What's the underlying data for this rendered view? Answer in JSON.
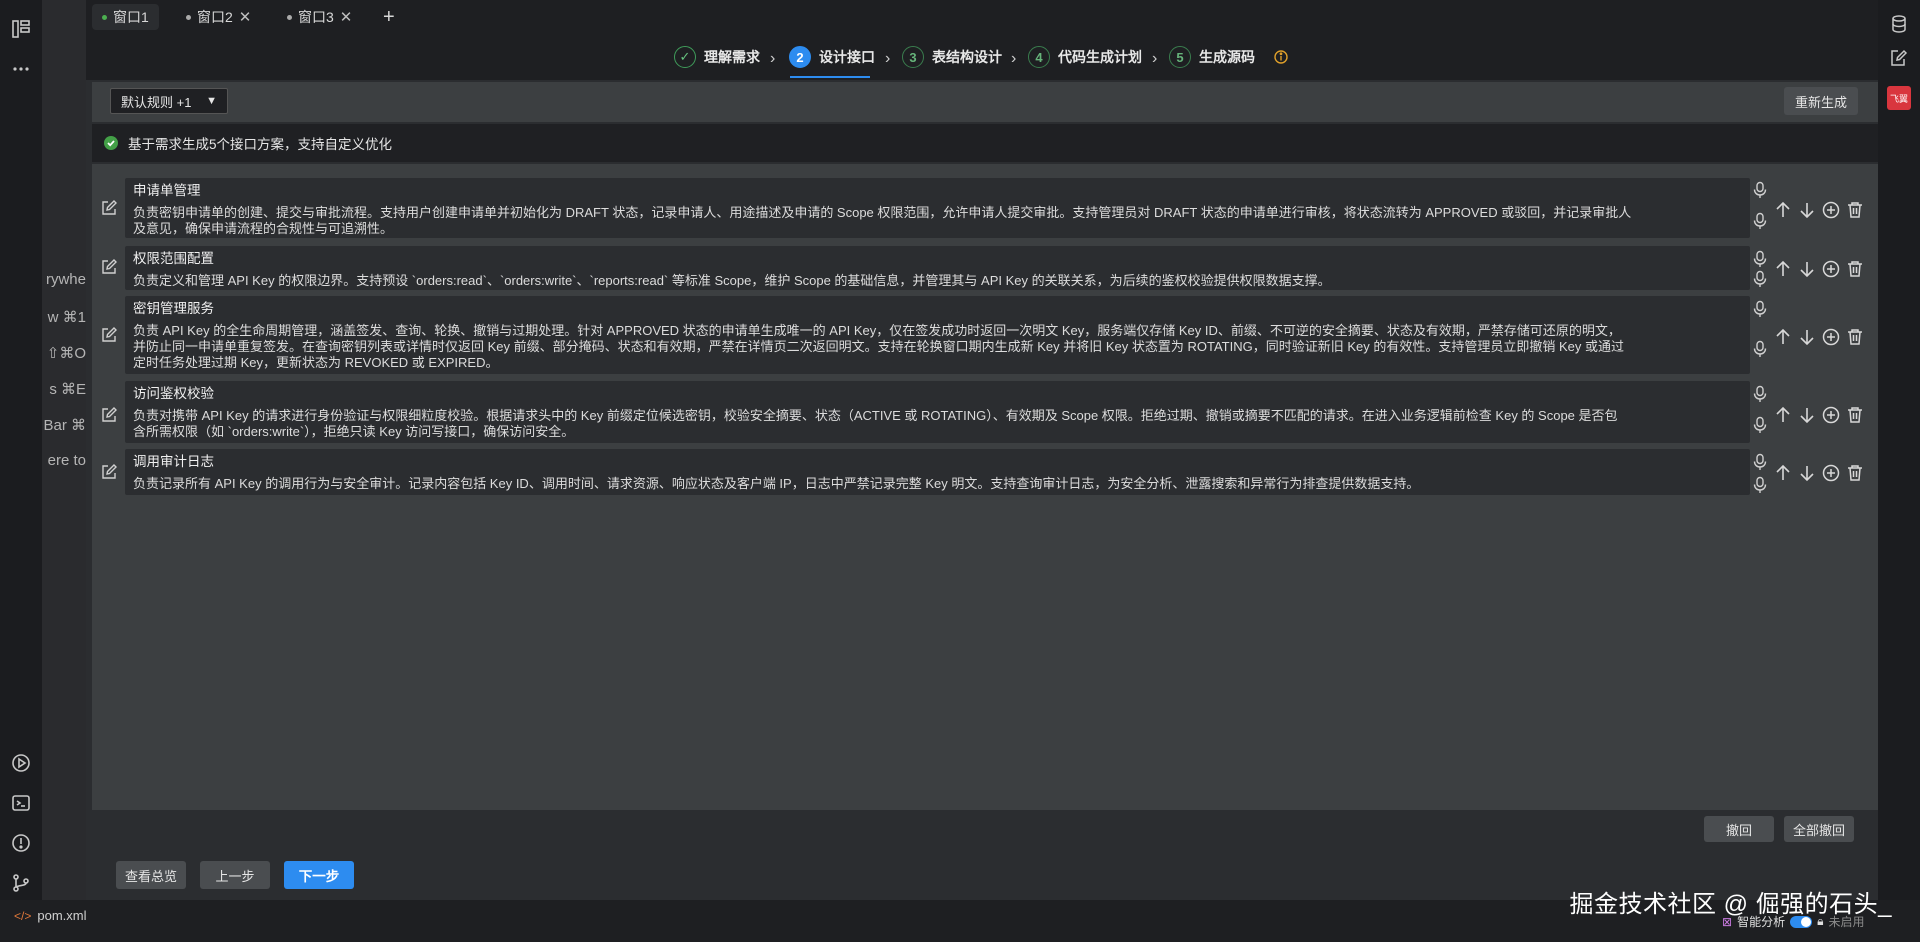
{
  "tabs": [
    {
      "label": "窗口1",
      "active": true
    },
    {
      "label": "窗口2",
      "active": false
    },
    {
      "label": "窗口3",
      "active": false
    }
  ],
  "add_tab_symbol": "+",
  "steps": [
    {
      "number": "✓",
      "label": "理解需求",
      "state": "done"
    },
    {
      "number": "2",
      "label": "设计接口",
      "state": "active"
    },
    {
      "number": "3",
      "label": "表结构设计",
      "state": "pending"
    },
    {
      "number": "4",
      "label": "代码生成计划",
      "state": "pending"
    },
    {
      "number": "5",
      "label": "生成源码",
      "state": "pending"
    }
  ],
  "toolbar": {
    "rule_select": "默认规则 +1",
    "regenerate_label": "重新生成"
  },
  "notice": {
    "text": "基于需求生成5个接口方案，支持自定义优化"
  },
  "items": [
    {
      "title": "申请单管理",
      "desc_lines": [
        "负责密钥申请单的创建、提交与审批流程。支持用户创建申请单并初始化为 DRAFT 状态，记录申请人、用途描述及申请的 Scope 权限范围，允许申请人提交审批。支持管理员对 DRAFT 状态的申请单进行审核，将状态流转为 APPROVED 或驳回，并记录审批人",
        "及意见，确保申请流程的合规性与可追溯性。"
      ]
    },
    {
      "title": "权限范围配置",
      "desc_lines": [
        "负责定义和管理 API Key 的权限边界。支持预设 `orders:read`、`orders:write`、`reports:read` 等标准 Scope，维护 Scope 的基础信息，并管理其与 API Key 的关联关系，为后续的鉴权校验提供权限数据支撑。"
      ]
    },
    {
      "title": "密钥管理服务",
      "desc_lines": [
        "负责 API Key 的全生命周期管理，涵盖签发、查询、轮换、撤销与过期处理。针对 APPROVED 状态的申请单生成唯一的 API Key，仅在签发成功时返回一次明文 Key，服务端仅存储 Key ID、前缀、不可逆的安全摘要、状态及有效期，严禁存储可还原的明文，",
        "并防止同一申请单重复签发。在查询密钥列表或详情时仅返回 Key 前缀、部分掩码、状态和有效期，严禁在详情页二次返回明文。支持在轮换窗口期内生成新 Key 并将旧 Key 状态置为 ROTATING，同时验证新旧 Key 的有效性。支持管理员立即撤销 Key 或通过",
        "定时任务处理过期 Key，更新状态为 REVOKED 或 EXPIRED。"
      ]
    },
    {
      "title": "访问鉴权校验",
      "desc_lines": [
        "负责对携带 API Key 的请求进行身份验证与权限细粒度校验。根据请求头中的 Key 前缀定位候选密钥，校验安全摘要、状态（ACTIVE 或 ROTATING）、有效期及 Scope 权限。拒绝过期、撤销或摘要不匹配的请求。在进入业务逻辑前检查 Key 的 Scope 是否包",
        "含所需权限（如 `orders:write`），拒绝只读 Key 访问写接口，确保访问安全。"
      ]
    },
    {
      "title": "调用审计日志",
      "desc_lines": [
        "负责记录所有 API Key 的调用行为与安全审计。记录内容包括 Key ID、调用时间、请求资源、响应状态及客户端 IP，日志中严禁记录完整 Key 明文。支持查询审计日志，为安全分析、泄露搜索和异常行为排查提供数据支持。"
      ]
    }
  ],
  "undo": {
    "undo_label": "撤回",
    "undo_all_label": "全部撤回"
  },
  "footer": {
    "overview_label": "查看总览",
    "prev_label": "上一步",
    "next_label": "下一步"
  },
  "behind_menu": [
    "rywhe",
    "w  ⌘1",
    "⇧⌘O",
    "s  ⌘E",
    "Bar  ⌘",
    "ere to"
  ],
  "statusbar": {
    "file": "pom.xml",
    "analysis_label": "智能分析",
    "disabled_label": "未启用",
    "watermark": "掘金技术社区 @ 倔强的石头_"
  },
  "right_bar": {
    "badge": "飞翼"
  },
  "colors": {
    "accent": "#2d8cf0",
    "success": "#43a047",
    "badge": "#d9363e"
  }
}
